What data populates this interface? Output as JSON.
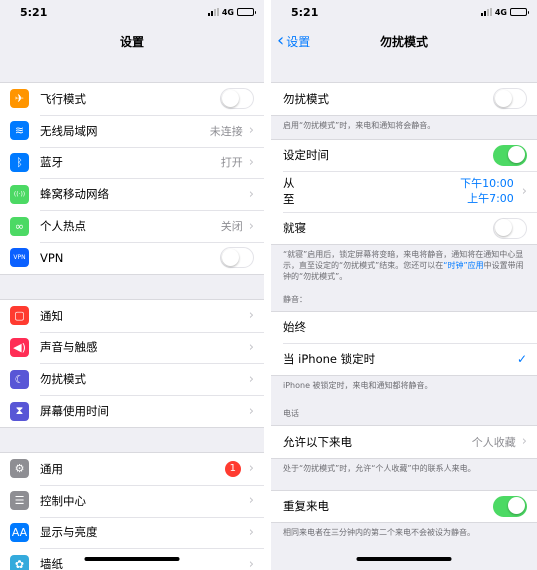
{
  "left": {
    "status": {
      "time": "5:21",
      "network": "4G"
    },
    "title": "设置",
    "groups": [
      [
        {
          "label": "飞行模式",
          "icon": "airplane-icon",
          "color": "#ff9500",
          "glyph": "✈",
          "toggle": false
        },
        {
          "label": "无线局域网",
          "icon": "wifi-icon",
          "color": "#007aff",
          "glyph": "≋",
          "value": "未连接"
        },
        {
          "label": "蓝牙",
          "icon": "bluetooth-icon",
          "color": "#007aff",
          "glyph": "ᛒ",
          "value": "打开"
        },
        {
          "label": "蜂窝移动网络",
          "icon": "cellular-icon",
          "color": "#4cd964",
          "glyph": "((·))"
        },
        {
          "label": "个人热点",
          "icon": "hotspot-icon",
          "color": "#4cd964",
          "glyph": "∞",
          "value": "关闭"
        },
        {
          "label": "VPN",
          "icon": "vpn-icon",
          "color": "#0a60ff",
          "glyph": "VPN",
          "toggle": false
        }
      ],
      [
        {
          "label": "通知",
          "icon": "notifications-icon",
          "color": "#ff3b30",
          "glyph": "▢"
        },
        {
          "label": "声音与触感",
          "icon": "sound-icon",
          "color": "#ff2d55",
          "glyph": "◀)"
        },
        {
          "label": "勿扰模式",
          "icon": "moon-icon",
          "color": "#5856d6",
          "glyph": "☾"
        },
        {
          "label": "屏幕使用时间",
          "icon": "screen-time-icon",
          "color": "#5856d6",
          "glyph": "⧗"
        }
      ],
      [
        {
          "label": "通用",
          "icon": "gear-icon",
          "color": "#8e8e93",
          "glyph": "⚙",
          "badge": "1"
        },
        {
          "label": "控制中心",
          "icon": "control-center-icon",
          "color": "#8e8e93",
          "glyph": "☰"
        },
        {
          "label": "显示与亮度",
          "icon": "display-icon",
          "color": "#007aff",
          "glyph": "AA"
        },
        {
          "label": "墙纸",
          "icon": "wallpaper-icon",
          "color": "#34aadc",
          "glyph": "✿"
        }
      ]
    ]
  },
  "right": {
    "status": {
      "time": "5:21",
      "network": "4G"
    },
    "back": "设置",
    "title": "勿扰模式",
    "dnd": {
      "label": "勿扰模式",
      "on": false,
      "note": "启用“勿扰模式”时，来电和通知将会静音。"
    },
    "schedule": {
      "label": "设定时间",
      "on": true,
      "from_label": "从",
      "to_label": "至",
      "from_time": "下午10:00",
      "to_time": "上午7:00",
      "bedtime_label": "就寝",
      "bedtime_on": false,
      "note_pre": "“就寝”启用后，锁定屏幕将变暗，来电将静音，通知将在通知中心显示，直至设定的“勿扰模式”结束。您还可以在",
      "note_link": "“时钟”应用",
      "note_post": "中设置带闹钟的“勿扰模式”。"
    },
    "silence": {
      "header": "静音：",
      "always": "始终",
      "locked": "当 iPhone 锁定时",
      "note": "iPhone 被锁定时，来电和通知都将静音。"
    },
    "phone": {
      "header": "电话",
      "allow_label": "允许以下来电",
      "allow_value": "个人收藏",
      "allow_note": "处于“勿扰模式”时，允许“个人收藏”中的联系人来电。",
      "repeat_label": "重复来电",
      "repeat_on": true,
      "repeat_note": "相同来电者在三分钟内的第二个来电不会被设为静音。"
    }
  }
}
